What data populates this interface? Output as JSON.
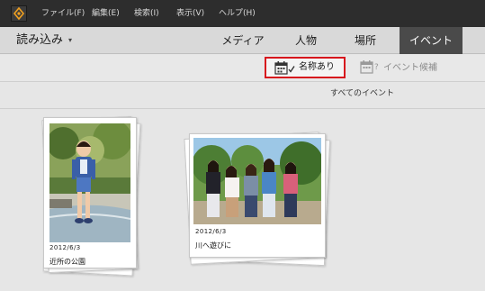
{
  "menu": {
    "logo_icon": "elements-organizer-icon",
    "items": [
      "ファイル(F)",
      "編集(E)",
      "検索(I)",
      "表示(V)",
      "ヘルプ(H)"
    ]
  },
  "nav": {
    "import_label": "読み込み",
    "import_arrow": "▾",
    "tabs": [
      "メディア",
      "人物",
      "場所",
      "イベント"
    ],
    "active_tab": "イベント"
  },
  "toolbar": {
    "named_label": "名称あり",
    "named_icon": "calendar-check-icon",
    "candidates_label": "イベント候補",
    "candidates_icon": "calendar-question-icon",
    "highlight_color": "#d7161d"
  },
  "section_title": "すべてのイベント",
  "events": [
    {
      "date": "2012/6/3",
      "name": "近所の公園"
    },
    {
      "date": "2012/6/3",
      "name": "川へ遊びに"
    }
  ]
}
